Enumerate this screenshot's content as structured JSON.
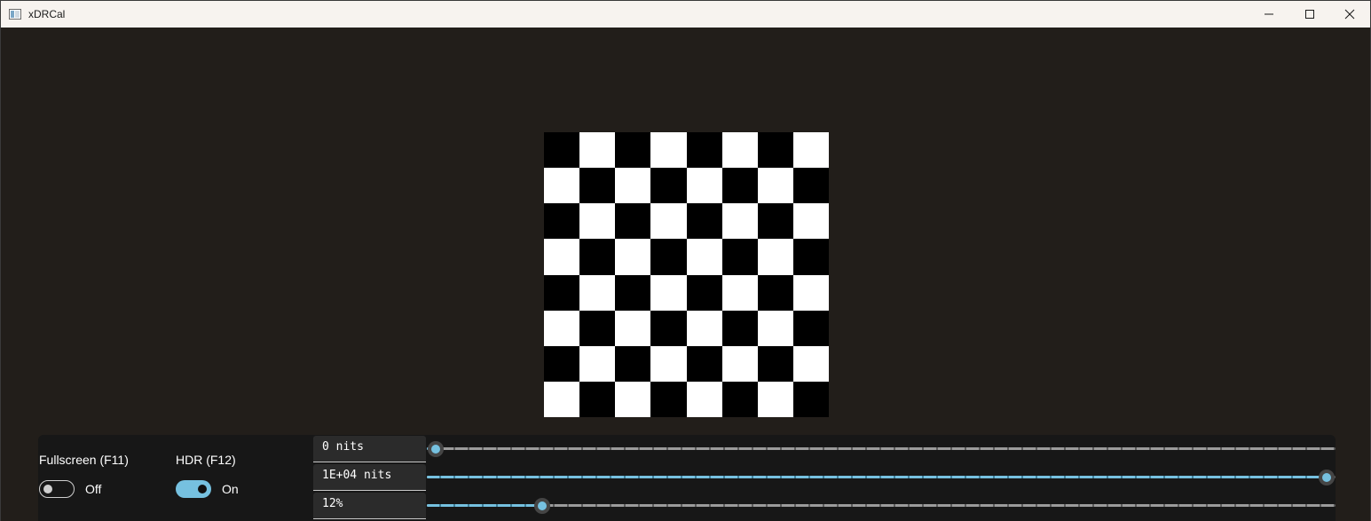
{
  "window": {
    "title": "xDRCal"
  },
  "checkerboard": {
    "rows": 8,
    "cols": 8,
    "first_cell": "black"
  },
  "controls": {
    "fullscreen": {
      "label": "Fullscreen (F11)",
      "state_text": "Off",
      "enabled": false
    },
    "hdr": {
      "label": "HDR (F12)",
      "state_text": "On",
      "enabled": true
    },
    "sliders": [
      {
        "value_text": "0 nits",
        "fraction": 0.0
      },
      {
        "value_text": "1E+04 nits",
        "fraction": 1.0
      },
      {
        "value_text": "12%",
        "fraction": 0.12
      }
    ]
  },
  "colors": {
    "accent": "#76c1e0",
    "background": "#221e1a",
    "panel": "#171717"
  },
  "icons": {
    "app": "app-icon",
    "minimize": "minimize-icon",
    "maximize": "maximize-icon",
    "close": "close-icon"
  }
}
